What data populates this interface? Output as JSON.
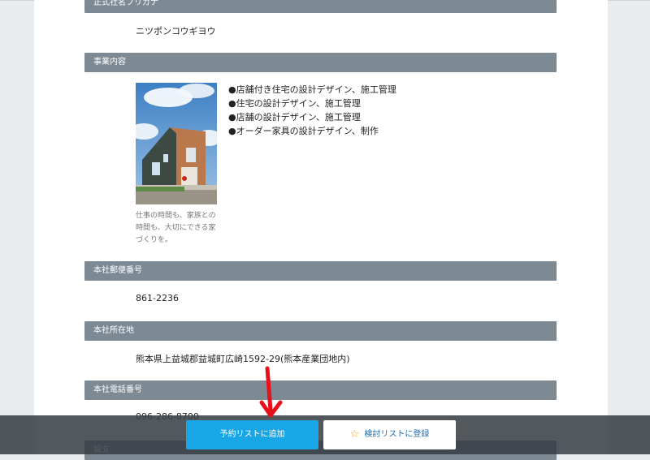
{
  "sections": {
    "furigana": {
      "label": "正式社名フリガナ",
      "value": "ニツポンコウギヨウ"
    },
    "business": {
      "label": "事業内容",
      "caption": "仕事の時間も、家族との時間も、大切にできる家づくりを。",
      "items": [
        "●店舗付き住宅の設計デザイン、施工管理",
        "●住宅の設計デザイン、施工管理",
        "●店舗の設計デザイン、施工管理",
        "●オーダー家具の設計デザイン、制作"
      ]
    },
    "postal": {
      "label": "本社郵便番号",
      "value": "861-2236"
    },
    "address": {
      "label": "本社所在地",
      "value": "熊本県上益城郡益城町広崎1592-29(熊本産業団地内)"
    },
    "phone": {
      "label": "本社電話番号",
      "value": "096-286-8700"
    },
    "established": {
      "label": "設立"
    }
  },
  "actions": {
    "reserve_label": "予約リストに追加",
    "consider_label": "検討リストに登録"
  },
  "colors": {
    "section_header": "#7d8a94",
    "primary_button": "#19a6e6",
    "arrow": "#e8101a",
    "star": "#f0a21c"
  }
}
